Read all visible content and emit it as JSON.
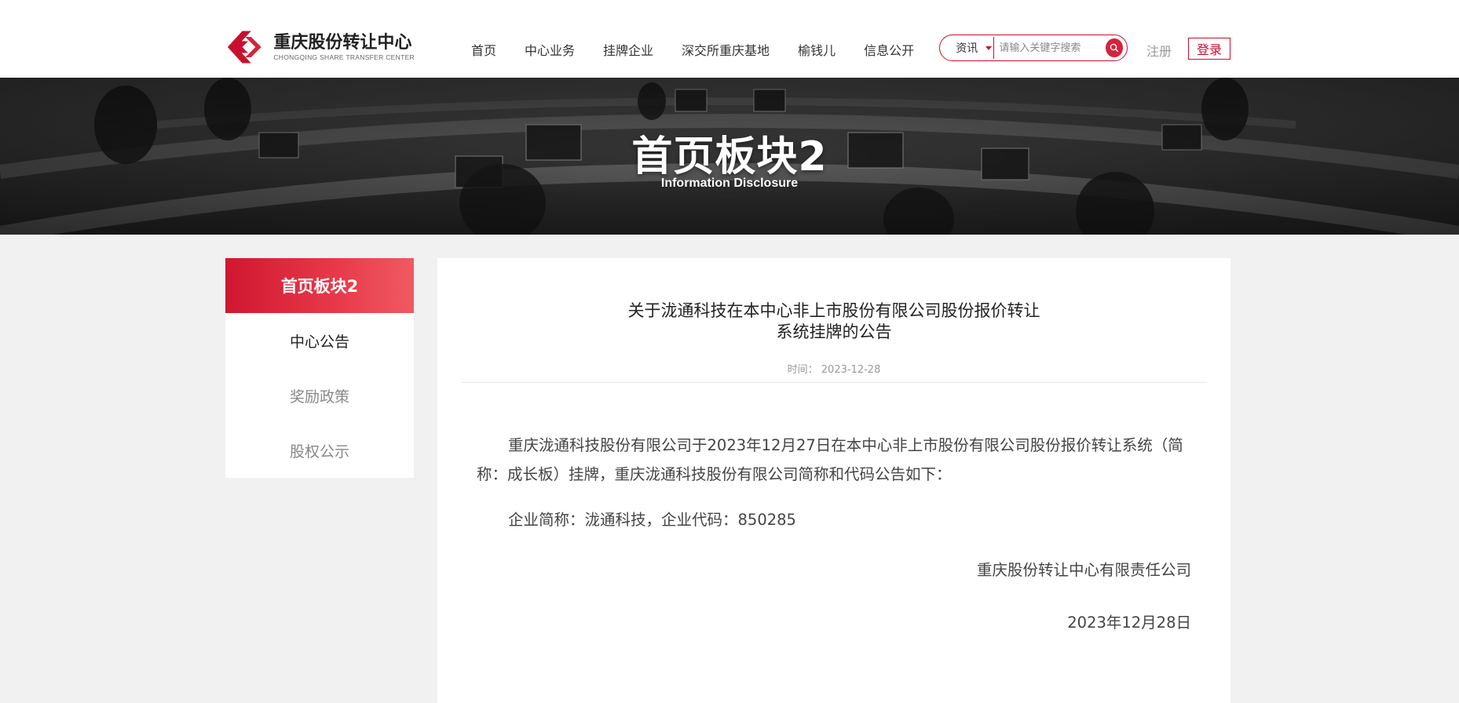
{
  "header": {
    "logo": {
      "cn": "重庆股份转让中心",
      "en": "CHONGQING SHARE TRANSFER CENTER"
    },
    "nav": [
      "首页",
      "中心业务",
      "挂牌企业",
      "深交所重庆基地",
      "榆钱儿",
      "信息公开"
    ],
    "search": {
      "category": "资讯",
      "placeholder": "请输入关键字搜索"
    },
    "register_label": "注册",
    "login_label": "登录"
  },
  "banner": {
    "title": "首页板块2",
    "subtitle": "Information Disclosure"
  },
  "sidebar": {
    "heading": "首页板块2",
    "items": [
      {
        "label": "中心公告",
        "active": true
      },
      {
        "label": "奖励政策",
        "active": false
      },
      {
        "label": "股权公示",
        "active": false
      }
    ]
  },
  "article": {
    "title_line1": "关于泷通科技在本中心非上市股份有限公司股份报价转让",
    "title_line2": "系统挂牌的公告",
    "date": "时间：  2023-12-28",
    "paragraph1": "重庆泷通科技股份有限公司于2023年12月27日在本中心非上市股份有限公司股份报价转让系统（简称：成长板）挂牌，重庆泷通科技股份有限公司简称和代码公告如下：",
    "paragraph2": "企业简称：泷通科技，企业代码：850285",
    "signature": "重庆股份转让中心有限责任公司",
    "sign_date": "2023年12月28日"
  },
  "colors": {
    "brand_red": "#c8102e",
    "background": "#f1f1f1"
  }
}
